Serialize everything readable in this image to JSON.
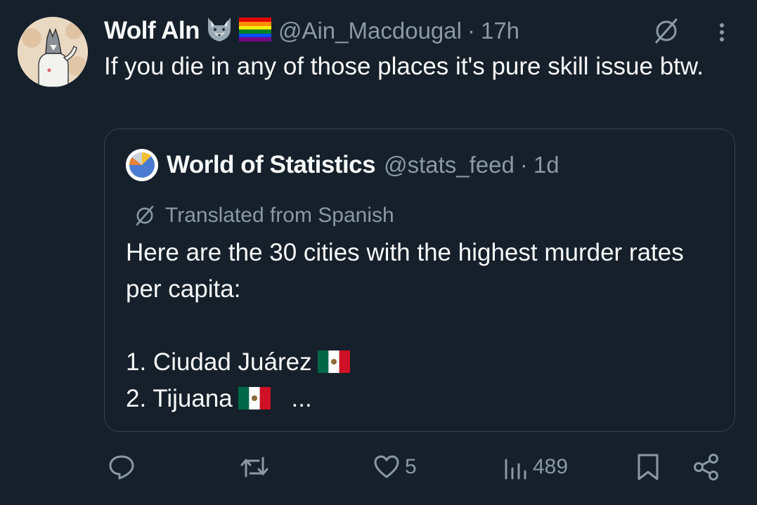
{
  "tweet": {
    "author": {
      "display_name": "Wolf Aln",
      "emoji_badges": [
        "wolf-emoji",
        "rainbow-flag-emoji"
      ],
      "handle": "@Ain_Macdougal",
      "separator": "·",
      "time": "17h"
    },
    "text": "If you die in any of those places it's pure skill issue btw.",
    "quote": {
      "author": {
        "display_name": "World of Statistics",
        "handle": "@stats_feed",
        "separator": "·",
        "time": "1d"
      },
      "translated_label": "Translated from Spanish",
      "text_intro": "Here are the 30 cities with the highest murder rates per capita:",
      "list_items": [
        {
          "label": "1. Ciudad Juárez",
          "flag": "mexico-flag"
        },
        {
          "label": "2. Tijuana",
          "flag": "mexico-flag"
        }
      ],
      "truncation": "..."
    },
    "actions": {
      "reply_icon": "reply-icon",
      "repost_icon": "repost-icon",
      "like_icon": "heart-icon",
      "like_count": "5",
      "views_icon": "views-icon",
      "views_count": "489",
      "bookmark_icon": "bookmark-icon",
      "share_icon": "share-icon"
    }
  },
  "colors": {
    "background": "#15202b",
    "text_primary": "#f7f9f9",
    "text_secondary": "#8b98a5",
    "border": "#38444d"
  }
}
